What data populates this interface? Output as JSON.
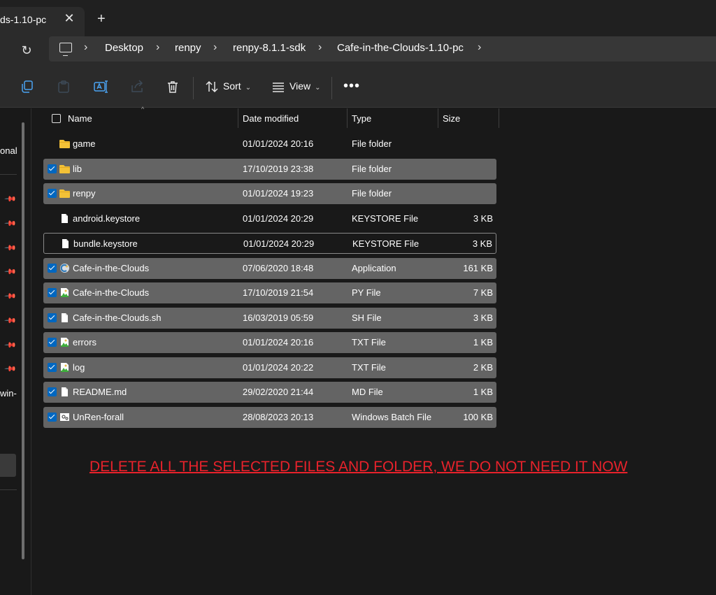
{
  "tab": {
    "title": "ds-1.10-pc",
    "close_glyph": "✕",
    "new_tab_glyph": "+"
  },
  "address": {
    "refresh_glyph": "↻",
    "crumbs": [
      "Desktop",
      "renpy",
      "renpy-8.1.1-sdk",
      "Cafe-in-the-Clouds-1.10-pc"
    ],
    "separator": "›"
  },
  "toolbar": {
    "sort_label": "Sort",
    "view_label": "View",
    "chevron": "⌄",
    "more_glyph": "•••",
    "icons": [
      "copy-icon",
      "paste-icon",
      "rename-icon",
      "share-icon",
      "delete-icon",
      "sort-icon",
      "view-icon"
    ]
  },
  "sidebar": {
    "text_top": "onal",
    "text_bottom": "win-",
    "pin_glyph": "📌"
  },
  "columns": {
    "name": "Name",
    "date": "Date modified",
    "type": "Type",
    "size": "Size",
    "sort_glyph": "^"
  },
  "files": [
    {
      "name": "game",
      "date": "01/01/2024 20:16",
      "type": "File folder",
      "size": "",
      "icon": "folder",
      "selected": false
    },
    {
      "name": "lib",
      "date": "17/10/2019 23:38",
      "type": "File folder",
      "size": "",
      "icon": "folder",
      "selected": true
    },
    {
      "name": "renpy",
      "date": "01/01/2024 19:23",
      "type": "File folder",
      "size": "",
      "icon": "folder",
      "selected": true
    },
    {
      "name": "android.keystore",
      "date": "01/01/2024 20:29",
      "type": "KEYSTORE File",
      "size": "3 KB",
      "icon": "file",
      "selected": false
    },
    {
      "name": "bundle.keystore",
      "date": "01/01/2024 20:29",
      "type": "KEYSTORE File",
      "size": "3 KB",
      "icon": "file",
      "selected": false
    },
    {
      "name": "Cafe-in-the-Clouds",
      "date": "07/06/2020 18:48",
      "type": "Application",
      "size": "161 KB",
      "icon": "app",
      "selected": true
    },
    {
      "name": "Cafe-in-the-Clouds",
      "date": "17/10/2019 21:54",
      "type": "PY File",
      "size": "7 KB",
      "icon": "image-file",
      "selected": true
    },
    {
      "name": "Cafe-in-the-Clouds.sh",
      "date": "16/03/2019 05:59",
      "type": "SH File",
      "size": "3 KB",
      "icon": "file",
      "selected": true
    },
    {
      "name": "errors",
      "date": "01/01/2024 20:16",
      "type": "TXT File",
      "size": "1 KB",
      "icon": "image-file",
      "selected": true
    },
    {
      "name": "log",
      "date": "01/01/2024 20:22",
      "type": "TXT File",
      "size": "2 KB",
      "icon": "image-file",
      "selected": true
    },
    {
      "name": "README.md",
      "date": "29/02/2020 21:44",
      "type": "MD File",
      "size": "1 KB",
      "icon": "file",
      "selected": true
    },
    {
      "name": "UnRen-forall",
      "date": "28/08/2023 20:13",
      "type": "Windows Batch File",
      "size": "100 KB",
      "icon": "batch-file",
      "selected": true
    }
  ],
  "annotation": "DELETE ALL THE SELECTED FILES AND FOLDER, WE DO NOT NEED IT NOW",
  "colors": {
    "selection": "#646464",
    "checkbox": "#0067c0",
    "annotation": "#e8222b",
    "folder": "#f3c137"
  }
}
